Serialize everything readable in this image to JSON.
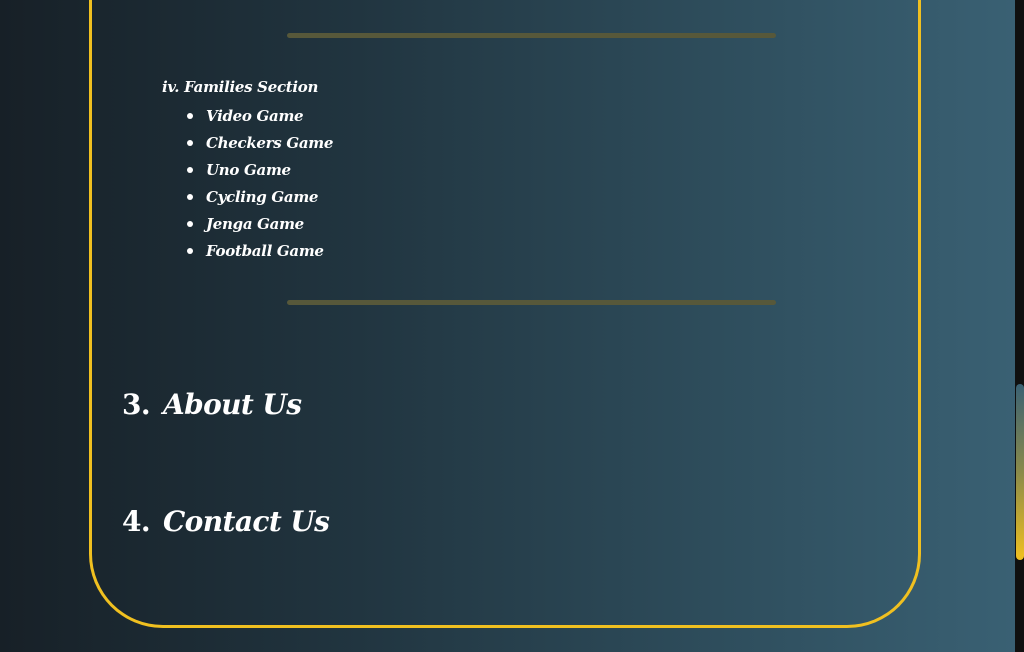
{
  "families_section": {
    "title": "iv. Families Section",
    "games": [
      "Video Game",
      "Checkers Game",
      "Uno Game",
      "Cycling Game",
      "Jenga Game",
      "Football Game"
    ]
  },
  "headings": [
    {
      "number": "3.",
      "label": "About Us"
    },
    {
      "number": "4.",
      "label": "Contact Us"
    }
  ],
  "colors": {
    "accent": "#f0c020",
    "divider": "#57583a",
    "text": "#ffffff"
  }
}
